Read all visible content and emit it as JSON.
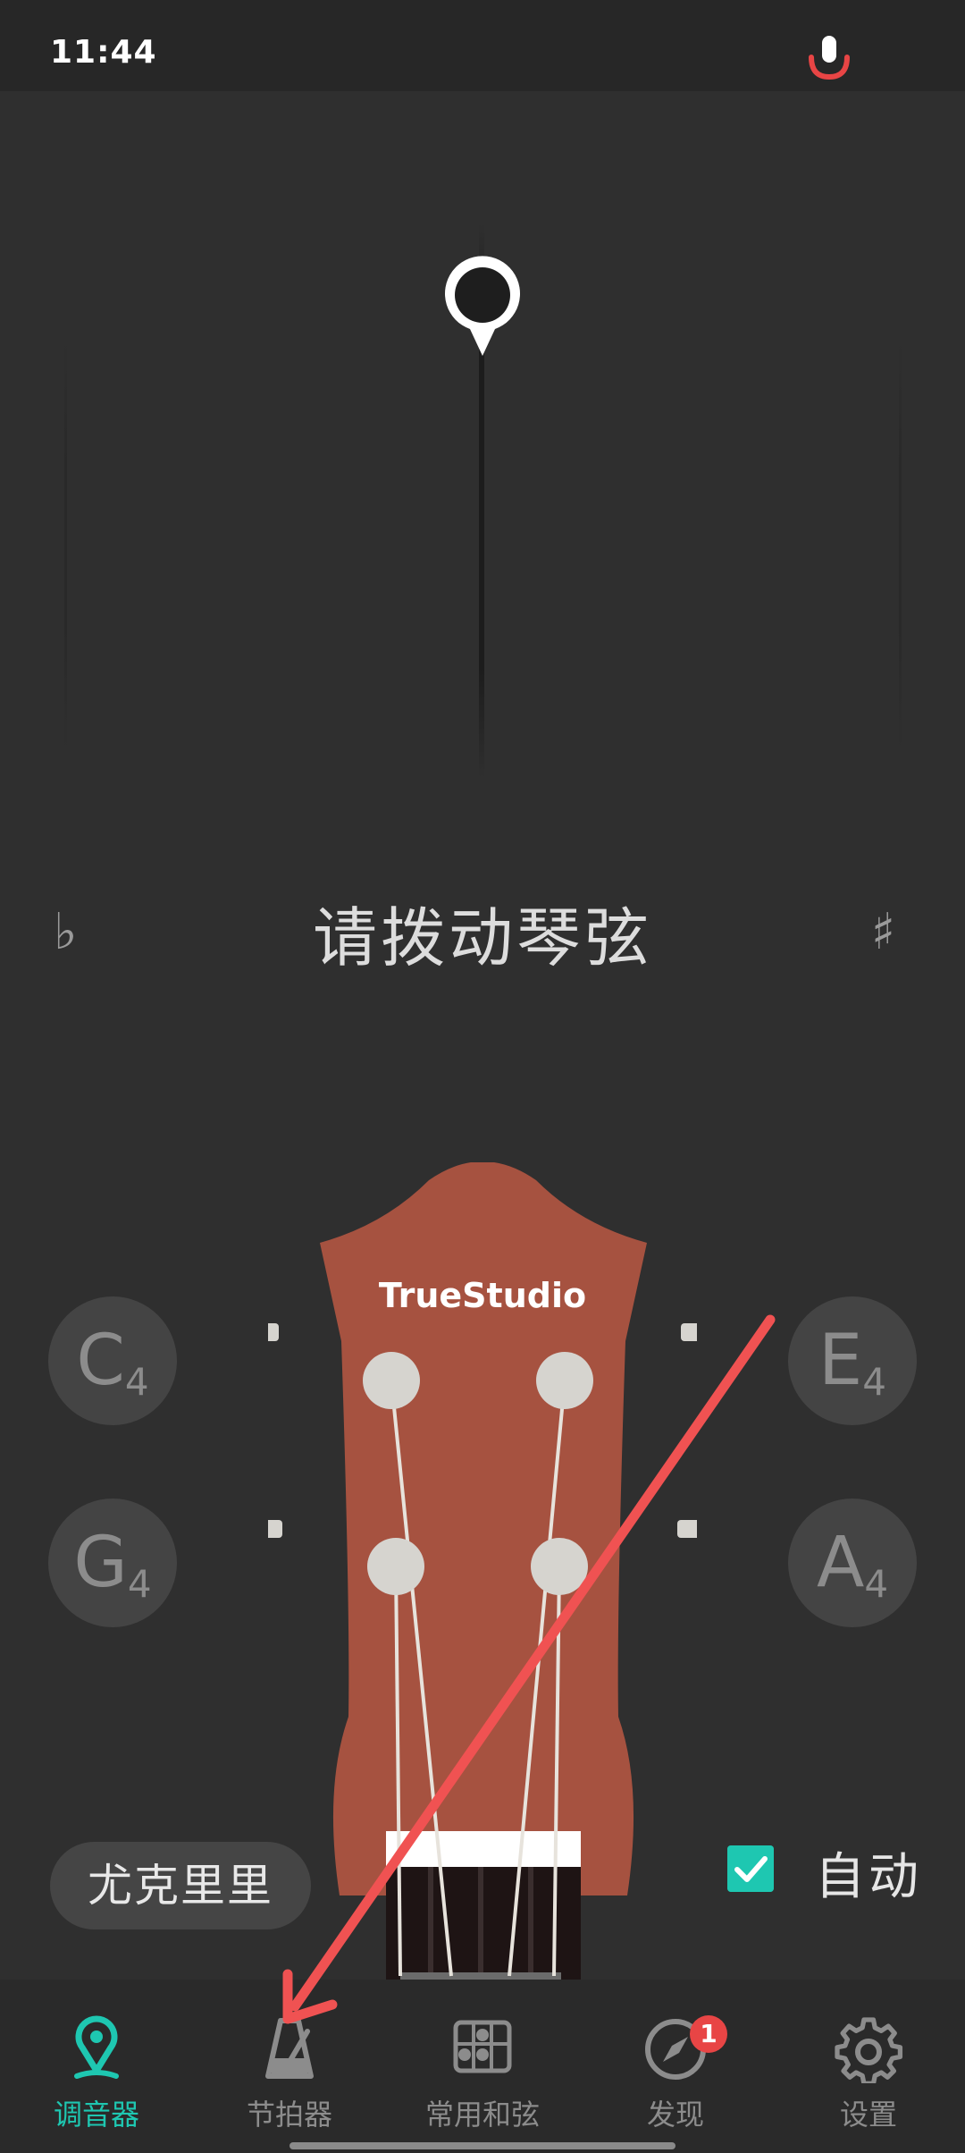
{
  "status_bar": {
    "time": "11:44",
    "mic_icon": "microphone-icon",
    "mic_color": "#e84545"
  },
  "tuner": {
    "prompt": "请拨动琴弦",
    "flat": "♭",
    "sharp": "♯"
  },
  "headstock": {
    "brand": "TrueStudio",
    "body_color": "#a65240"
  },
  "strings": [
    {
      "note": "C",
      "octave": "4"
    },
    {
      "note": "E",
      "octave": "4"
    },
    {
      "note": "G",
      "octave": "4"
    },
    {
      "note": "A",
      "octave": "4"
    }
  ],
  "controls": {
    "instrument": "尤克里里",
    "auto_label": "自动",
    "auto_checked": true
  },
  "bottom_nav": {
    "items": [
      {
        "label": "调音器",
        "icon": "tuner-pin-icon",
        "active": true
      },
      {
        "label": "节拍器",
        "icon": "metronome-icon",
        "active": false
      },
      {
        "label": "常用和弦",
        "icon": "chord-chart-icon",
        "active": false
      },
      {
        "label": "发现",
        "icon": "compass-icon",
        "active": false,
        "badge": "1"
      },
      {
        "label": "设置",
        "icon": "gear-icon",
        "active": false
      }
    ]
  },
  "colors": {
    "accent": "#1ec7b1",
    "background": "#2f2f2f",
    "annotation_arrow": "#f05252"
  }
}
